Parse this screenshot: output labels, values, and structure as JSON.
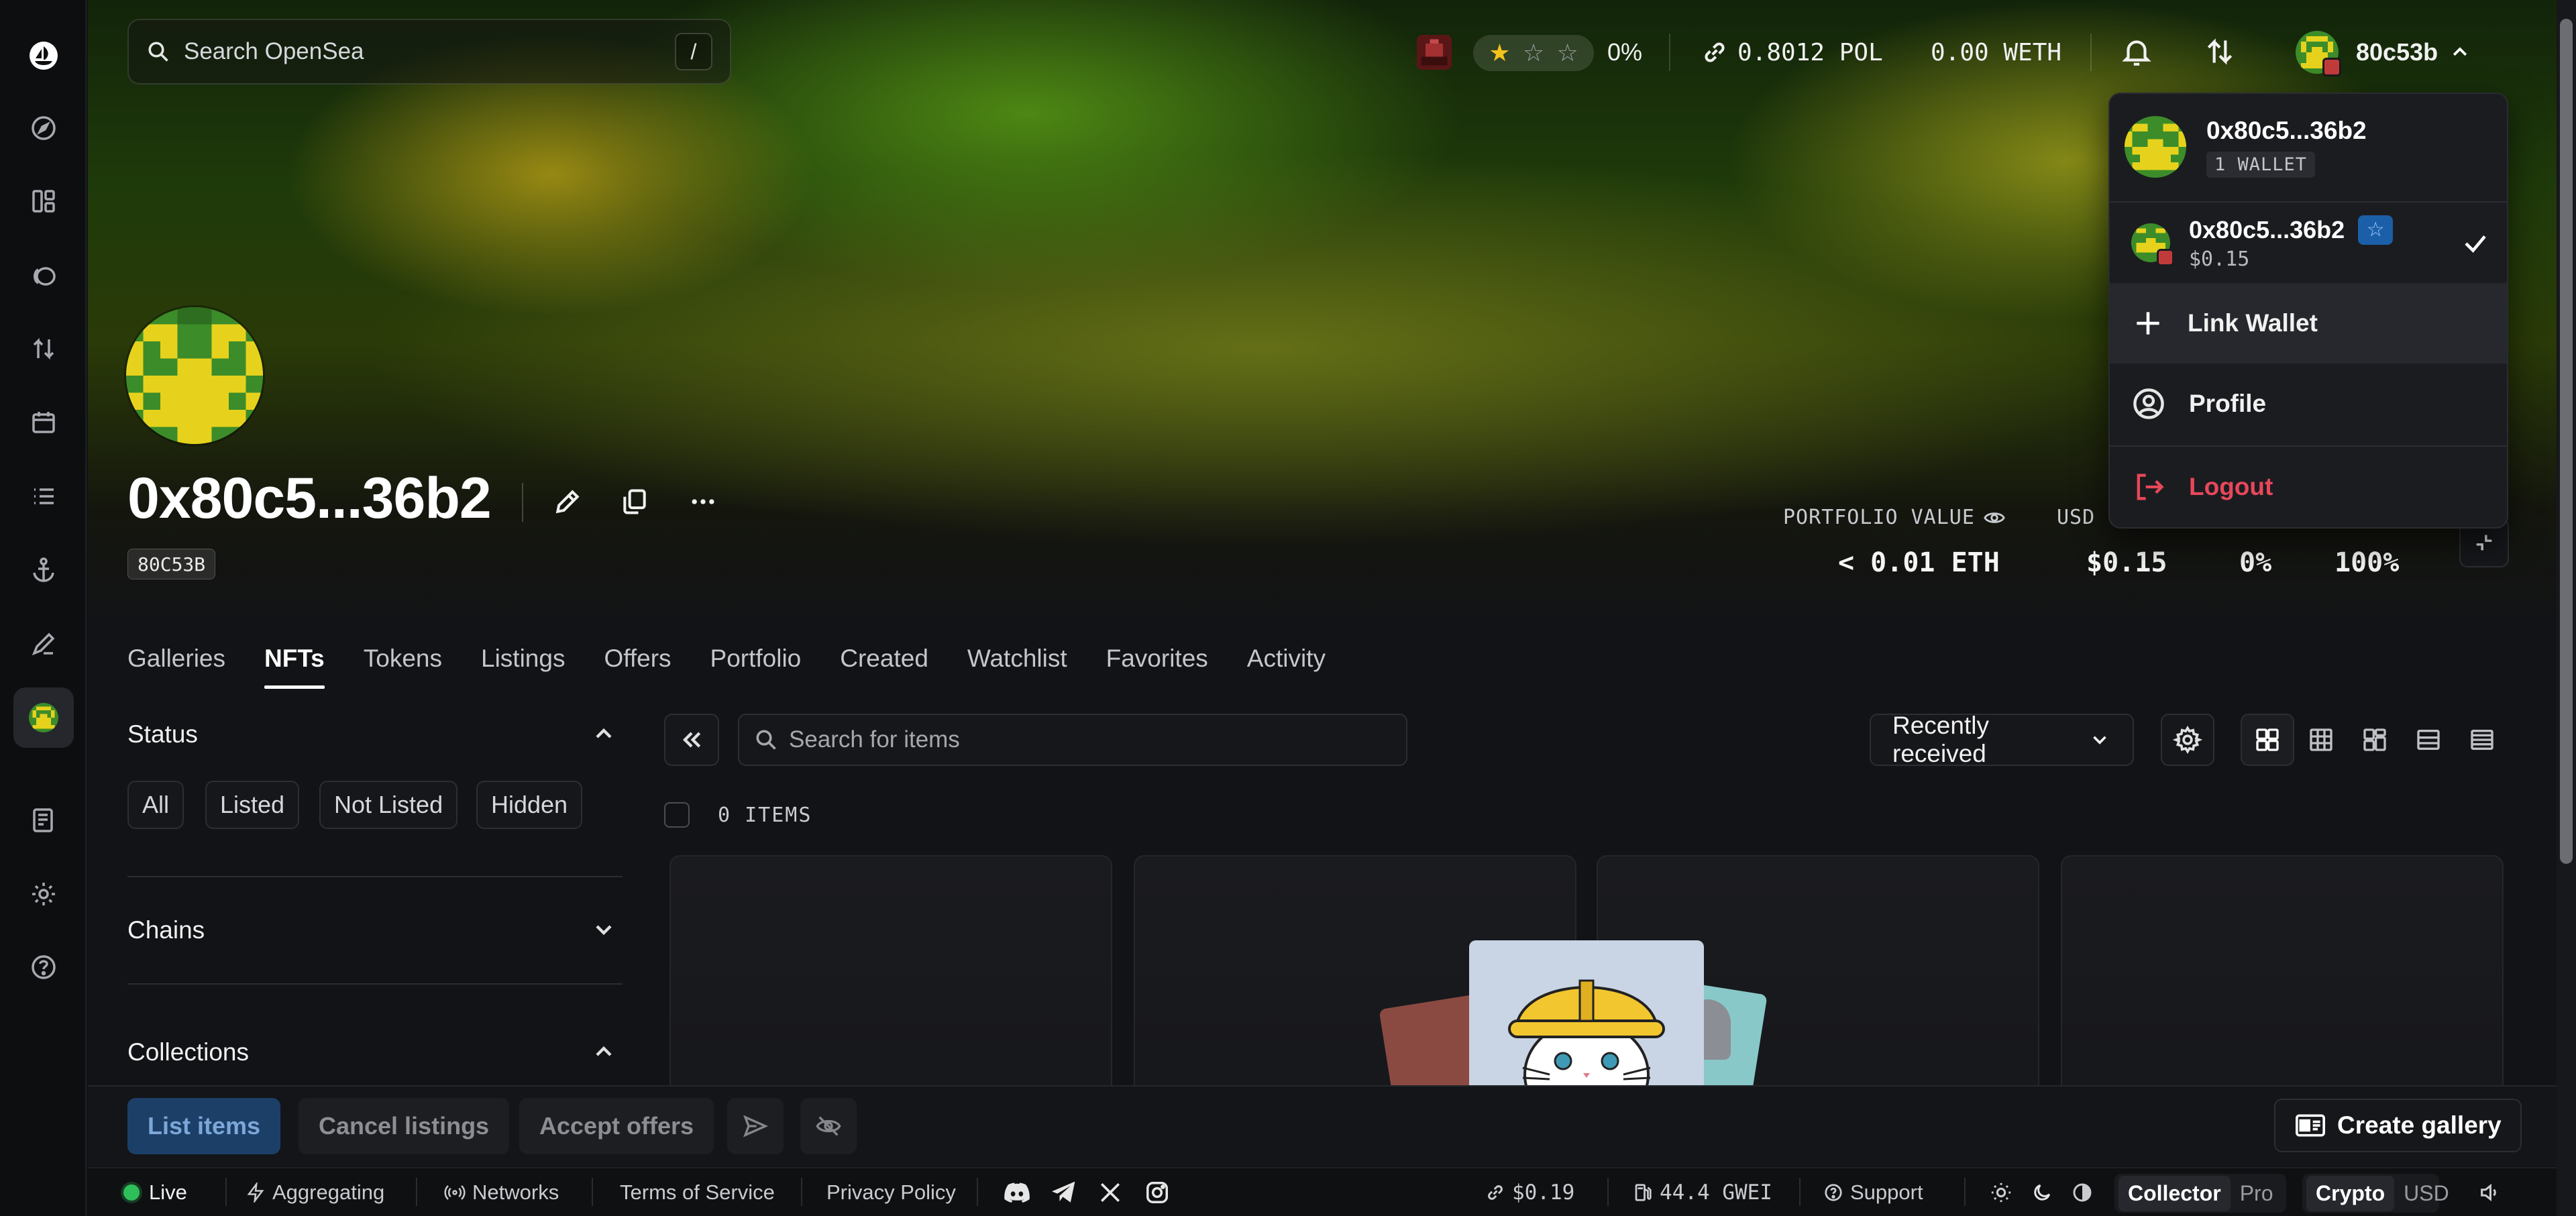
{
  "search": {
    "placeholder": "Search OpenSea",
    "shortcut": "/"
  },
  "topbar": {
    "rating_percent": "0%",
    "pol_balance": "0.8012 POL",
    "weth_balance": "0.00 WETH",
    "account_short": "80c53b"
  },
  "profile": {
    "name": "0x80c5...36b2",
    "tag": "80C53B",
    "portfolio_label": "PORTFOLIO VALUE",
    "usd_label": "USD",
    "eth_value": "< 0.01 ETH",
    "usd_value": "$0.15",
    "change": "0%",
    "percent": "100%"
  },
  "tabs": [
    "Galleries",
    "NFTs",
    "Tokens",
    "Listings",
    "Offers",
    "Portfolio",
    "Created",
    "Watchlist",
    "Favorites",
    "Activity"
  ],
  "filters": {
    "status_title": "Status",
    "chips": [
      "All",
      "Listed",
      "Not Listed",
      "Hidden"
    ],
    "chains_title": "Chains",
    "collections_title": "Collections"
  },
  "items": {
    "search_placeholder": "Search for items",
    "sort_label": "Recently received",
    "count_label": "0 ITEMS"
  },
  "actions": {
    "list_items": "List items",
    "cancel_listings": "Cancel listings",
    "accept_offers": "Accept offers",
    "create_gallery": "Create gallery"
  },
  "status_bar": {
    "live": "Live",
    "aggregating": "Aggregating",
    "networks": "Networks",
    "terms": "Terms of Service",
    "privacy": "Privacy Policy",
    "pol_price": "$0.19",
    "gas": "44.4 GWEI",
    "support": "Support",
    "mode_collector": "Collector",
    "mode_pro": "Pro",
    "currency_crypto": "Crypto",
    "currency_usd": "USD"
  },
  "dropdown": {
    "header_address": "0x80c5...36b2",
    "wallet_count": "1 WALLET",
    "wallet_address": "0x80c5...36b2",
    "wallet_balance": "$0.15",
    "link_wallet": "Link Wallet",
    "profile": "Profile",
    "logout": "Logout"
  },
  "colors": {
    "accent_blue": "#1c3f68",
    "logout_red": "#e8475a",
    "live_green": "#2fbf5a",
    "pfp_green": "#3c8c2a",
    "pfp_yellow": "#e6d21c"
  }
}
